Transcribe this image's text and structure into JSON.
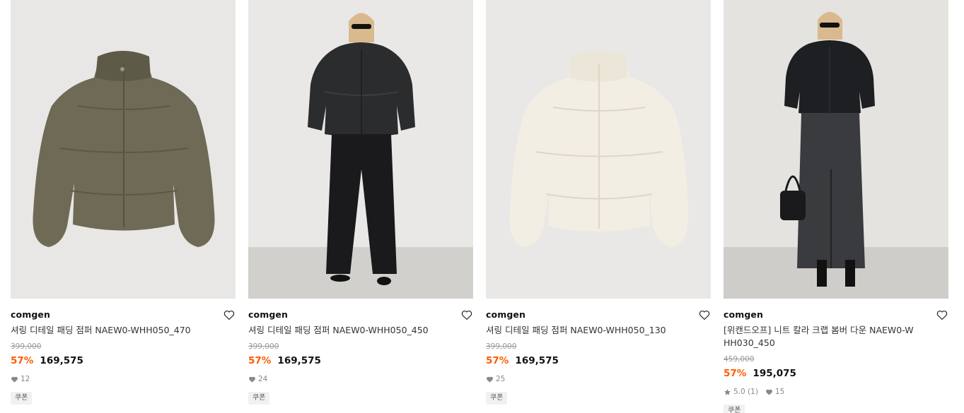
{
  "products": [
    {
      "brand": "comgen",
      "title": "셔링 디테일 패딩 점퍼 NAEW0-WHH050_470",
      "original_price": "399,000",
      "discount": "57%",
      "price": "169,575",
      "rating": "",
      "likes": "12",
      "badge": "쿠폰",
      "image": {
        "background": "#e8e7e5",
        "garment_color": "#6e6a56",
        "type": "jacket"
      }
    },
    {
      "brand": "comgen",
      "title": "셔링 디테일 패딩 점퍼 NAEW0-WHH050_450",
      "original_price": "399,000",
      "discount": "57%",
      "price": "169,575",
      "rating": "",
      "likes": "24",
      "badge": "쿠폰",
      "image": {
        "background": "#e9e8e6",
        "garment_color": "#2b2c2e",
        "type": "model"
      }
    },
    {
      "brand": "comgen",
      "title": "셔링 디테일 패딩 점퍼 NAEW0-WHH050_130",
      "original_price": "399,000",
      "discount": "57%",
      "price": "169,575",
      "rating": "",
      "likes": "25",
      "badge": "쿠폰",
      "image": {
        "background": "#e9e8e6",
        "garment_color": "#f2eee3",
        "type": "jacket"
      }
    },
    {
      "brand": "comgen",
      "title": "[위캔드오프] 니트 칼라 크랩 봄버 다운 NAEW0-WHH030_450",
      "original_price": "459,000",
      "discount": "57%",
      "price": "195,075",
      "rating": "5.0 (1)",
      "likes": "15",
      "badge": "쿠폰",
      "image": {
        "background": "#e4e3e0",
        "garment_color": "#1e1f22",
        "type": "model-skirt"
      }
    }
  ],
  "colors": {
    "discount": "#ff5a00",
    "strike": "#9a9a9a",
    "badge_bg": "#f1f1f1"
  },
  "icons": {
    "wish": "heart-outline-icon",
    "likes": "heart-filled-icon",
    "rating": "star-icon"
  }
}
